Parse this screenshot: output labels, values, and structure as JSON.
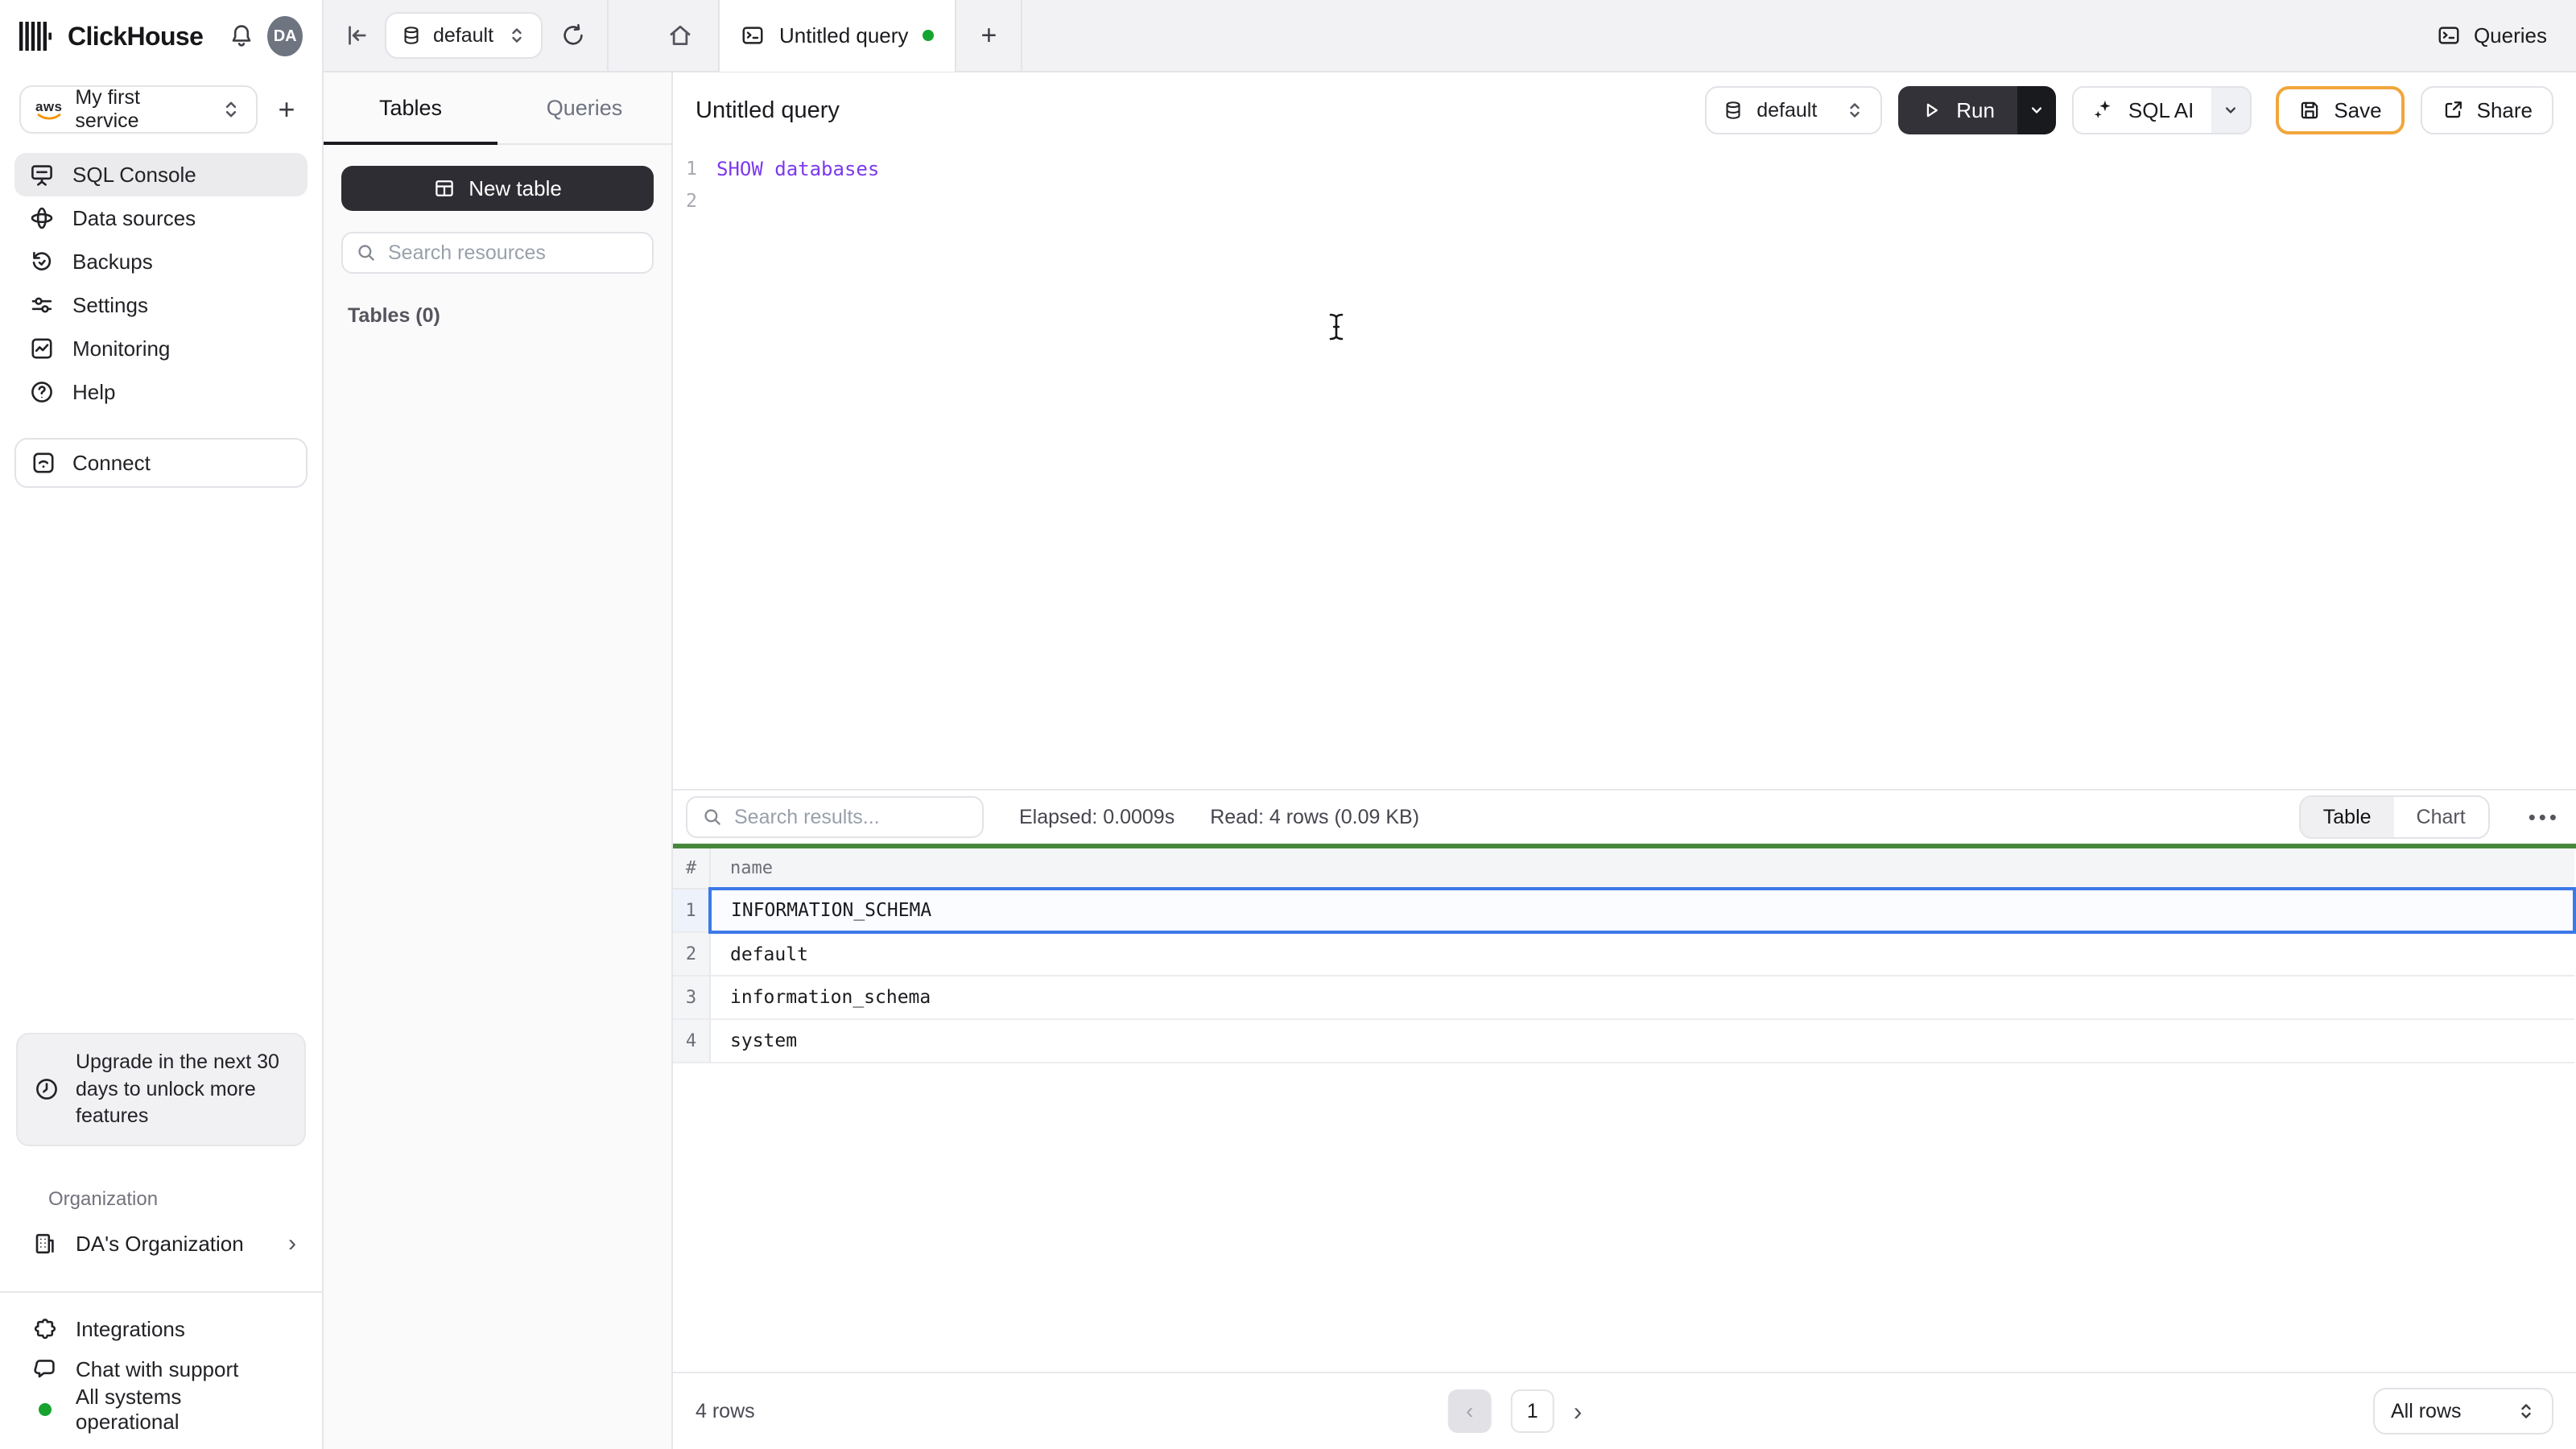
{
  "brand": {
    "name": "ClickHouse"
  },
  "topbar": {
    "avatar": "DA",
    "service": "My first service",
    "database": "default",
    "tab": "Untitled query",
    "queries": "Queries"
  },
  "sidebar": {
    "nav": [
      {
        "label": "SQL Console"
      },
      {
        "label": "Data sources"
      },
      {
        "label": "Backups"
      },
      {
        "label": "Settings"
      },
      {
        "label": "Monitoring"
      },
      {
        "label": "Help"
      }
    ],
    "connect": "Connect",
    "upgrade": "Upgrade in the next 30 days to unlock more features",
    "org_heading": "Organization",
    "org_name": "DA's Organization",
    "integrations": "Integrations",
    "chat": "Chat with support",
    "status": "All systems operational"
  },
  "explorer": {
    "tab_tables": "Tables",
    "tab_queries": "Queries",
    "new_table": "New table",
    "search_placeholder": "Search resources",
    "tables_count": "Tables (0)"
  },
  "editor": {
    "title": "Untitled query",
    "database": "default",
    "run": "Run",
    "sql_ai": "SQL AI",
    "save": "Save",
    "share": "Share",
    "lines": [
      {
        "n": "1",
        "code": "SHOW databases"
      },
      {
        "n": "2",
        "code": ""
      }
    ]
  },
  "results": {
    "search_placeholder": "Search results...",
    "elapsed": "Elapsed: 0.0009s",
    "read": "Read: 4 rows (0.09 KB)",
    "toggle_table": "Table",
    "toggle_chart": "Chart",
    "col_hash": "#",
    "col_name": "name",
    "rows": [
      {
        "n": "1",
        "name": "INFORMATION_SCHEMA"
      },
      {
        "n": "2",
        "name": "default"
      },
      {
        "n": "3",
        "name": "information_schema"
      },
      {
        "n": "4",
        "name": "system"
      }
    ],
    "row_count": "4 rows",
    "page": "1",
    "page_size": "All rows"
  },
  "colors": {
    "accent_green": "#47873c",
    "selected_blue": "#3b79e8",
    "save_border": "#f1a63c",
    "keyword_purple": "#7c3aed",
    "status_green": "#16a32f"
  }
}
